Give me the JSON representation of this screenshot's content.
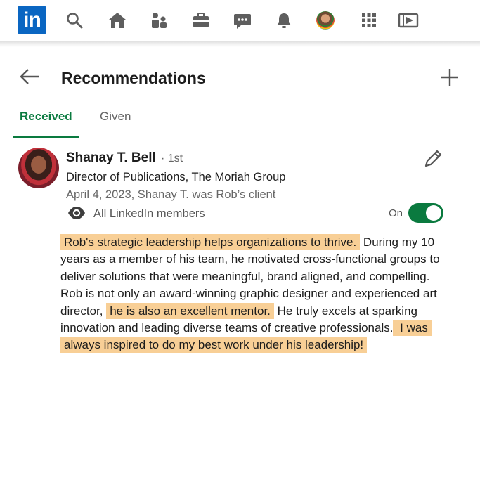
{
  "nav": {
    "logo_text": "in",
    "icons": [
      "search-icon",
      "home-icon",
      "network-icon",
      "jobs-icon",
      "messaging-icon",
      "notifications-icon",
      "profile-avatar",
      "apps-grid-icon",
      "learning-icon"
    ],
    "brand_color": "#0a66c2"
  },
  "header": {
    "title": "Recommendations"
  },
  "tabs": [
    {
      "label": "Received",
      "active": true
    },
    {
      "label": "Given",
      "active": false
    }
  ],
  "recommendation": {
    "name": "Shanay T. Bell",
    "degree": "· 1st",
    "title": "Director of Publications, The Moriah Group",
    "date_relation": "April 4, 2023, Shanay T. was Rob’s client",
    "visibility": "All LinkedIn members",
    "toggle_label": "On",
    "toggle_on": true,
    "body": [
      {
        "text": "Rob's strategic leadership helps organizations to thrive.",
        "highlight": true
      },
      {
        "text": " During my 10 years as a member of his team, he motivated cross-functional groups to deliver solutions that were meaningful, brand aligned, and compelling. Rob is not only an award-winning graphic designer and experienced art director, ",
        "highlight": false
      },
      {
        "text": "he is also an excellent mentor.",
        "highlight": true
      },
      {
        "text": " He truly excels at sparking innovation and leading diverse teams of creative professionals.",
        "highlight": false
      },
      {
        "text": " I was always inspired to do my best work under his leadership!",
        "highlight": true
      }
    ]
  },
  "colors": {
    "accent_green": "#0a7a3f",
    "highlight": "#f8cf96"
  }
}
